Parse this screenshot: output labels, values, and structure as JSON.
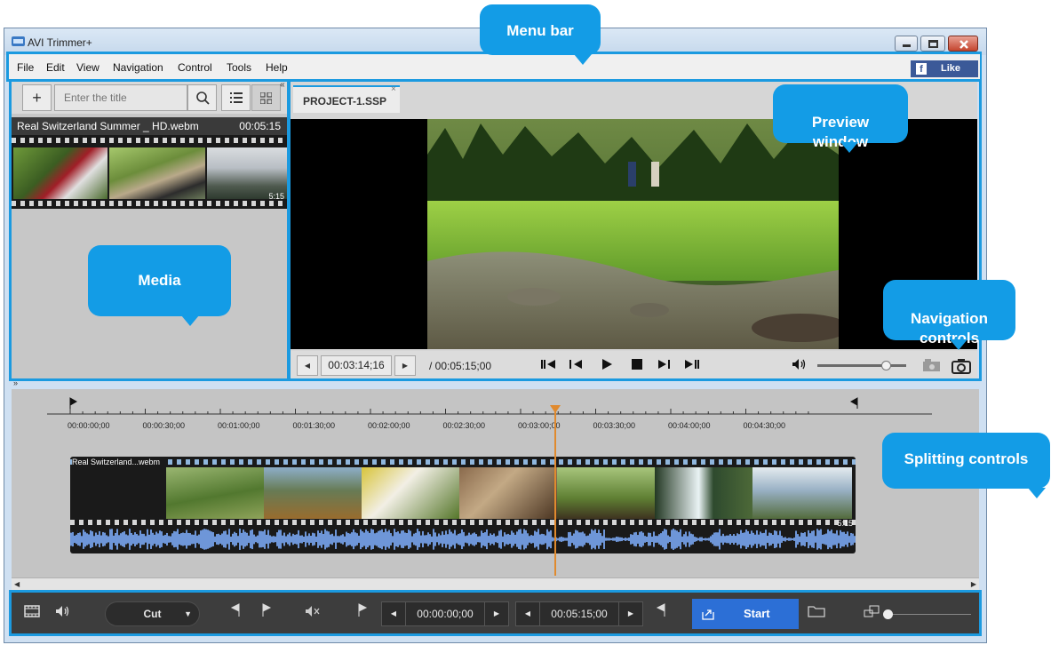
{
  "window": {
    "title": "AVI Trimmer+"
  },
  "menu": {
    "items": [
      "File",
      "Edit",
      "View",
      "Navigation",
      "Control",
      "Tools",
      "Help"
    ],
    "like_label": "Like",
    "facebook_glyph": "f"
  },
  "media": {
    "add_glyph": "+",
    "search_placeholder": "Enter the title",
    "item": {
      "name": "Real Switzerland Summer _ HD.webm",
      "duration": "00:05:15",
      "thumb_duration": "5:15"
    }
  },
  "preview": {
    "tab_label": "PROJECT-1.SSP",
    "tab_close_glyph": "×",
    "current_time": "00:03:14;16",
    "total_time": "/ 00:05:15;00",
    "volume_level": 0.77
  },
  "timeline": {
    "ticks": [
      "00:00:00;00",
      "00:00:30;00",
      "00:01:00;00",
      "00:01:30;00",
      "00:02:00;00",
      "00:02:30;00",
      "00:03:00;00",
      "00:03:30;00",
      "00:04:00;00",
      "00:04:30;00"
    ],
    "clip_name": "Real Switzerland...webm",
    "clip_duration": "5:15",
    "playhead_fraction": 0.616
  },
  "bottom": {
    "mode_label": "Cut",
    "start_time": "00:00:00;00",
    "end_time": "00:05:15;00",
    "start_button": "Start"
  },
  "callouts": {
    "menu_bar": "Menu bar",
    "preview_window": "Preview\nwindow",
    "media": "Media",
    "navigation_controls": "Navigation\ncontrols",
    "splitting_controls": "Splitting controls"
  },
  "colors": {
    "accent": "#1b9ae0",
    "callout": "#139ce6",
    "start_button": "#2c6fd6",
    "playhead": "#e08a2e",
    "waveform": "#6e96d8"
  }
}
